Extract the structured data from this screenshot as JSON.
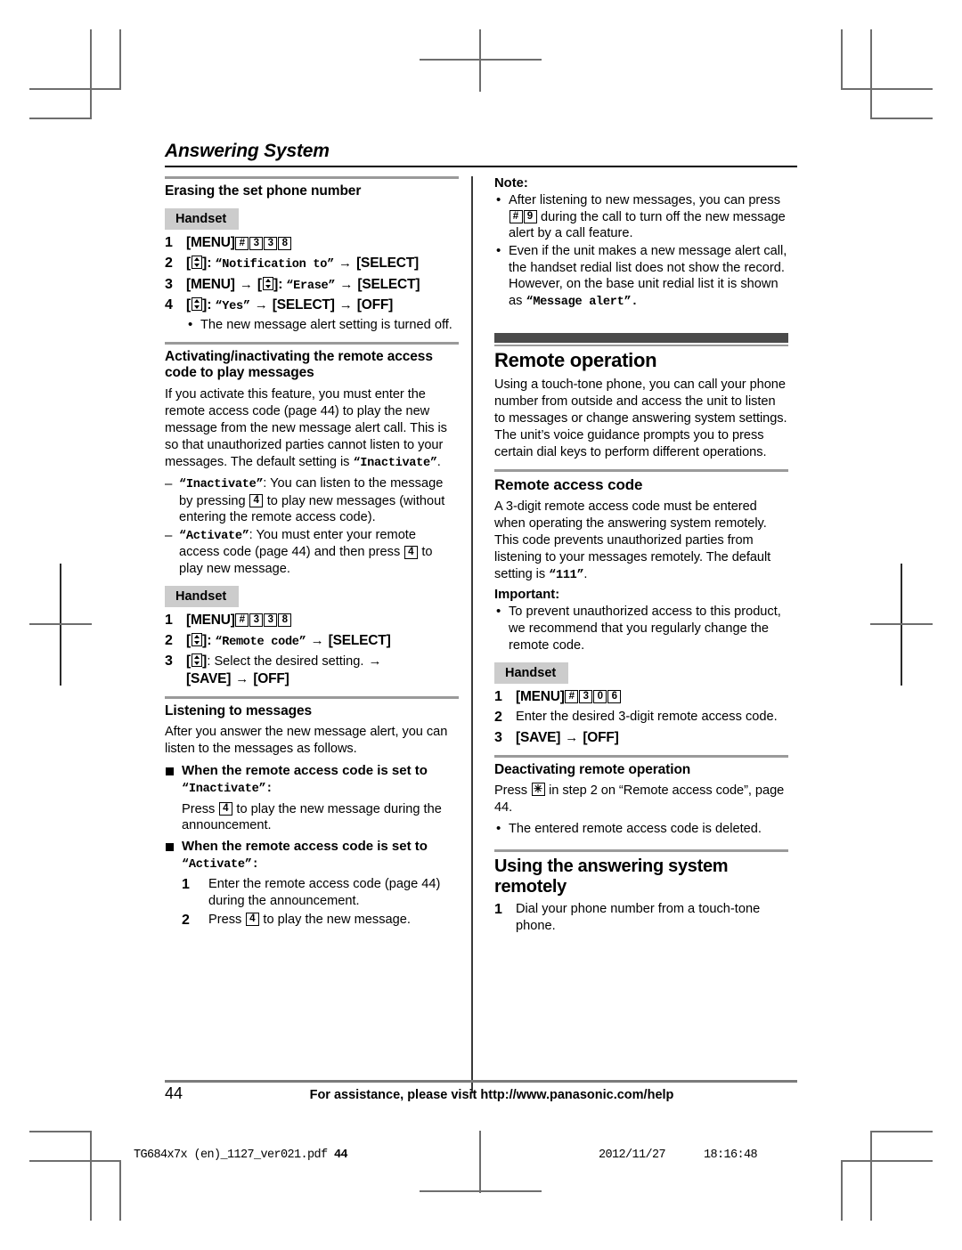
{
  "chapter": {
    "title": "Answering System"
  },
  "left": {
    "s1": {
      "heading": "Erasing the set phone number",
      "handset": "Handset",
      "steps": [
        {
          "num": "1",
          "menu": "[MENU]",
          "keys": [
            "#",
            "3",
            "3",
            "8"
          ]
        },
        {
          "num": "2",
          "prefix": "[",
          "suffix": "]:",
          "quote_open": "“",
          "display": "Notification to",
          "quote_close": "”",
          "arrow": "→",
          "tail": "[SELECT]"
        },
        {
          "num": "3",
          "lead": "[MENU]",
          "arrow1": "→",
          "nav_suffix": "]:",
          "quote_open": "“",
          "display": "Erase",
          "quote_close": "”",
          "arrow2": "→",
          "tail": "[SELECT]"
        },
        {
          "num": "4",
          "quote_open": "“",
          "display": "Yes",
          "quote_close": "”",
          "arrow1": "→",
          "mid": "[SELECT]",
          "arrow2": "→",
          "tail": "[OFF]"
        }
      ],
      "note_bullet": "The new message alert setting is turned off."
    },
    "s2": {
      "heading": "Activating/inactivating the remote access code to play messages",
      "para_a": "If you activate this feature, you must enter the remote access code (page 44) to play the new message from the new message alert call. This is so that unauthorized parties cannot listen to your messages. The default setting is ",
      "para_a_disp": "Inactivate",
      "dash1_disp": "Inactivate",
      "dash1_a": ": You can listen to the message by pressing ",
      "dash1_key": "4",
      "dash1_b": " to play new messages (without entering the remote access code).",
      "dash2_disp": "Activate",
      "dash2_a": ": You must enter your remote access code (page 44) and then press ",
      "dash2_key": "4",
      "dash2_b": " to play new message.",
      "handset": "Handset",
      "steps": [
        {
          "num": "1",
          "menu": "[MENU]",
          "keys": [
            "#",
            "3",
            "3",
            "8"
          ]
        },
        {
          "num": "2",
          "quote_open": "“",
          "display": "Remote code",
          "quote_close": "”",
          "arrow": "→",
          "tail": "[SELECT]"
        },
        {
          "num": "3",
          "text": ": Select the desired setting. ",
          "arrow1": "→",
          "tail1": "[SAVE]",
          "arrow2": "→",
          "tail2": "[OFF]"
        }
      ]
    },
    "s3": {
      "heading": "Listening to messages",
      "para": "After you answer the new message alert, you can listen to the messages as follows.",
      "sq1_a": "When the remote access code is set to ",
      "sq1_quote_open": "“",
      "sq1_disp": "Inactivate",
      "sq1_quote_close": "”:",
      "sq1_body_a": "Press ",
      "sq1_key": "4",
      "sq1_body_b": " to play the new message during the announcement.",
      "sq2_a": "When the remote access code is set to ",
      "sq2_quote_open": "“",
      "sq2_disp": "Activate",
      "sq2_quote_close": "”:",
      "sq2_steps": [
        {
          "num": "1",
          "text": "Enter the remote access code (page 44) during the announcement."
        },
        {
          "num": "2",
          "text_a": "Press ",
          "key": "4",
          "text_b": " to play the new message."
        }
      ]
    }
  },
  "right": {
    "note": {
      "label": "Note:",
      "b1_a": "After listening to new messages, you can press ",
      "b1_key1": "#",
      "b1_key2": "9",
      "b1_b": " during the call to turn off the new message alert by a call feature.",
      "b2_a": "Even if the unit makes a new message alert call, the handset redial list does not show the record. However, on the base unit redial list it is shown as ",
      "b2_quote_open": "“",
      "b2_disp": "Message alert",
      "b2_quote_close": "”."
    },
    "s1": {
      "heading": "Remote operation",
      "para": "Using a touch-tone phone, you can call your phone number from outside and access the unit to listen to messages or change answering system settings. The unit’s voice guidance prompts you to press certain dial keys to perform different operations."
    },
    "s2": {
      "heading": "Remote access code",
      "para_a": "A 3-digit remote access code must be entered when operating the answering system remotely. This code prevents unauthorized parties from listening to your messages remotely. The default setting is ",
      "para_disp": "111",
      "para_b": "”.",
      "important_label": "Important:",
      "important_bullet": "To prevent unauthorized access to this product, we recommend that you regularly change the remote code.",
      "handset": "Handset",
      "steps": [
        {
          "num": "1",
          "menu": "[MENU]",
          "keys": [
            "#",
            "3",
            "0",
            "6"
          ]
        },
        {
          "num": "2",
          "text": "Enter the desired 3-digit remote access code."
        },
        {
          "num": "3",
          "tail1": "[SAVE]",
          "arrow": "→",
          "tail2": "[OFF]"
        }
      ]
    },
    "s3": {
      "heading": "Deactivating remote operation",
      "para_a": "Press ",
      "key": "✳",
      "para_b": " in step 2 on “Remote access code”, page 44.",
      "bullet": "The entered remote access code is deleted."
    },
    "s4": {
      "heading": "Using the answering system remotely",
      "steps": [
        {
          "num": "1",
          "text": "Dial your phone number from a touch-tone phone."
        }
      ]
    }
  },
  "footer": {
    "page_number": "44",
    "assistance": "For assistance, please visit http://www.panasonic.com/help"
  },
  "printbar": {
    "file": "TG684x7x (en)_1127_ver021.pdf",
    "page": "44",
    "date": "2012/11/27",
    "time": "18:16:48"
  },
  "colors": {
    "bar_dark": "#4a4a4a",
    "rule_gray": "#9a9a9a",
    "handset_bg": "#cccccc",
    "crop_mark": "#6e6e6e"
  }
}
